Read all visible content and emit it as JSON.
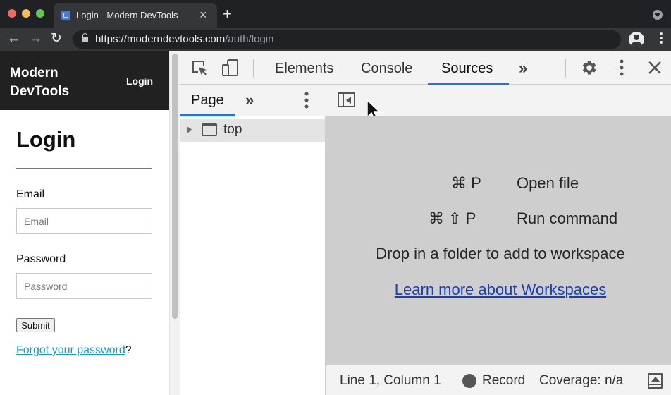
{
  "browser": {
    "tab_title": "Login - Modern DevTools",
    "tab_close": "×",
    "new_tab": "+",
    "url_host": "https://moderndevtools.com",
    "url_path": "/auth/login",
    "back_glyph": "←",
    "forward_glyph": "→",
    "reload_glyph": "↻",
    "star_glyph": "☆",
    "menu_glyph": "⋮"
  },
  "page": {
    "brand": "Modern DevTools",
    "nav_login": "Login",
    "title": "Login",
    "email_label": "Email",
    "email_placeholder": "Email",
    "password_label": "Password",
    "password_placeholder": "Password",
    "submit_label": "Submit",
    "forgot_link": "Forgot your password",
    "forgot_suffix": "?"
  },
  "devtools": {
    "tabs": [
      {
        "label": "Elements"
      },
      {
        "label": "Console"
      },
      {
        "label": "Sources",
        "active": true
      }
    ],
    "more_tabs_glyph": "»",
    "navigator": {
      "tab": "Page",
      "more_glyph": "»",
      "tree": [
        {
          "label": "top"
        }
      ]
    },
    "editor_empty": {
      "shortcuts": [
        {
          "keys": "⌘ P",
          "label": "Open file"
        },
        {
          "keys": "⌘ ⇧ P",
          "label": "Run command"
        }
      ],
      "drop_text": "Drop in a folder to add to workspace",
      "link": "Learn more about Workspaces"
    },
    "status": {
      "position": "Line 1, Column 1",
      "record": "Record",
      "coverage": "Coverage: n/a"
    }
  },
  "colors": {
    "accent": "#1a73e8",
    "link": "#1a9ec0",
    "workspace_link": "#1a3fb5",
    "site_header": "#212121"
  },
  "icons": [
    "lock-icon",
    "star-icon",
    "profile-icon",
    "inspect-icon",
    "device-toggle-icon",
    "gear-icon",
    "kebab-icon",
    "close-icon",
    "sidebar-toggle-icon",
    "frame-icon",
    "record-icon",
    "drawer-toggle-icon",
    "cursor-icon"
  ]
}
